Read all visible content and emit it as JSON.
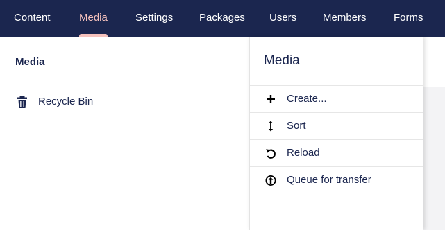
{
  "nav": {
    "items": [
      {
        "label": "Content"
      },
      {
        "label": "Media"
      },
      {
        "label": "Settings"
      },
      {
        "label": "Packages"
      },
      {
        "label": "Users"
      },
      {
        "label": "Members"
      },
      {
        "label": "Forms"
      }
    ],
    "active": "Media",
    "colors": {
      "background": "#1b264f",
      "text": "#ffffff",
      "active": "#f5c1bc"
    }
  },
  "tree": {
    "title": "Media",
    "items": [
      {
        "label": "Recycle Bin",
        "icon": "trash-icon"
      }
    ]
  },
  "context_menu": {
    "title": "Media",
    "items": [
      {
        "label": "Create...",
        "icon": "plus-icon"
      },
      {
        "label": "Sort",
        "icon": "sort-icon"
      },
      {
        "label": "Reload",
        "icon": "reload-icon"
      },
      {
        "label": "Queue for transfer",
        "icon": "upload-circle-icon"
      }
    ]
  }
}
